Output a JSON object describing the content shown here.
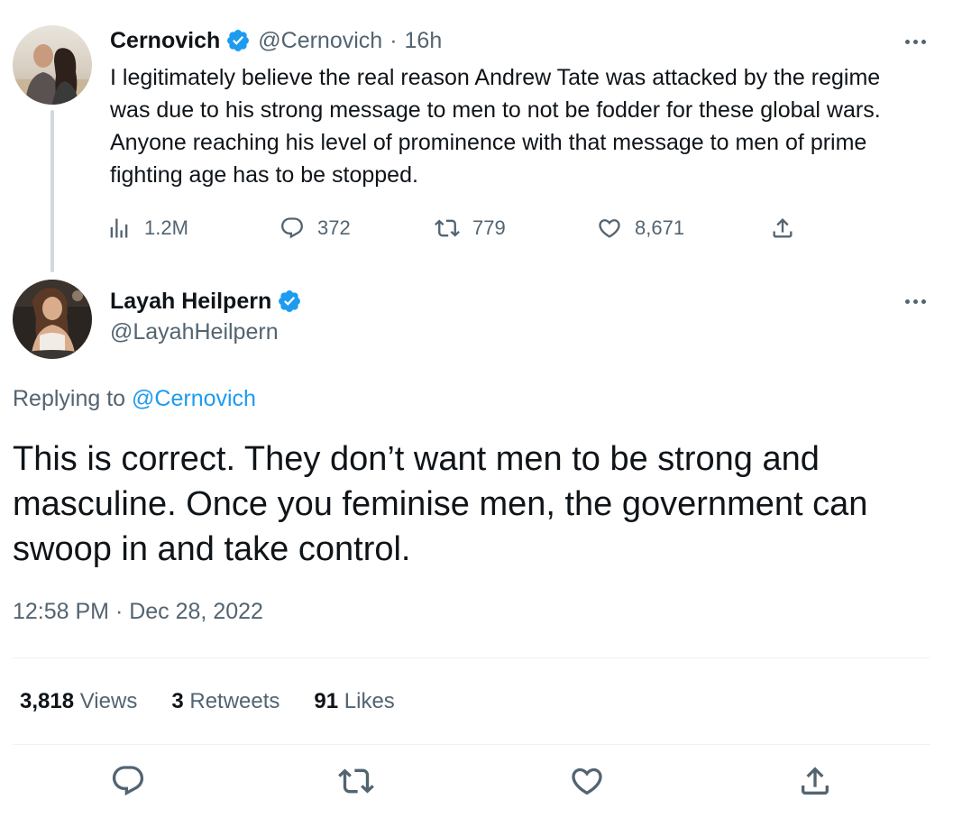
{
  "colors": {
    "text": "#0f1419",
    "secondary": "#536471",
    "accent": "#1d9bf0",
    "verified": "#1d9bf0",
    "thread_line": "#cfd9de",
    "divider": "#eff3f4"
  },
  "parent_tweet": {
    "author_name": "Cernovich",
    "handle": "@Cernovich",
    "separator": "·",
    "time_ago": "16h",
    "text": "I legitimately believe the real reason Andrew Tate was attacked by the regime was due to his strong message to men to not be fodder for these global wars. Anyone reaching his level of prominence with that message to men of prime fighting age has to be stopped.",
    "views": "1.2M",
    "replies": "372",
    "retweets": "779",
    "likes": "8,671",
    "icons": [
      "views-icon",
      "reply-icon",
      "retweet-icon",
      "like-icon",
      "share-icon",
      "more-icon",
      "verified-icon"
    ]
  },
  "focal_tweet": {
    "author_name": "Layah Heilpern",
    "handle": "@LayahHeilpern",
    "replying_prefix": "Replying to",
    "replying_to": "@Cernovich",
    "text": "This is correct. They don’t want men to be strong and masculine. Once you feminise men, the government can swoop in and take control.",
    "timestamp": "12:58 PM · Dec 28, 2022",
    "stats": {
      "views_count": "3,818",
      "views_label": "Views",
      "retweets_count": "3",
      "retweets_label": "Retweets",
      "likes_count": "91",
      "likes_label": "Likes"
    },
    "action_icons": [
      "reply-icon",
      "retweet-icon",
      "like-icon",
      "share-icon"
    ]
  }
}
